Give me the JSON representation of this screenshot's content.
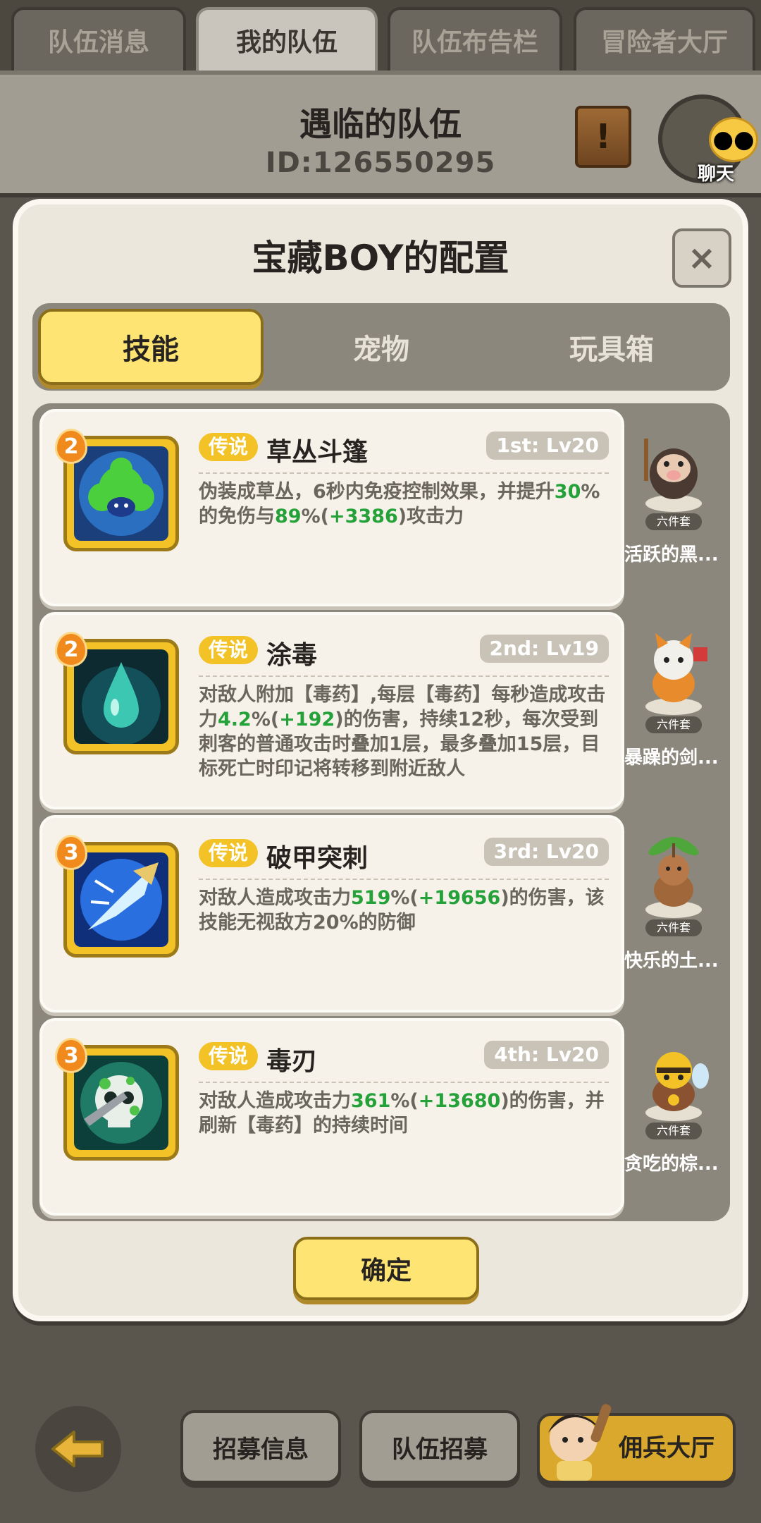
{
  "top_tabs": [
    "队伍消息",
    "我的队伍",
    "队伍布告栏",
    "冒险者大厅"
  ],
  "team": {
    "name": "遇临的队伍",
    "id": "ID:126550295"
  },
  "chat": {
    "label": "聊天"
  },
  "modal": {
    "title": "宝藏BOY的配置",
    "close_symbol": "×",
    "sub_tabs": [
      "技能",
      "宠物",
      "玩具箱"
    ],
    "confirm_label": "确定"
  },
  "skills": [
    {
      "rank": "2",
      "rarity": "传说",
      "name": "草丛斗篷",
      "level": "1st: Lv20",
      "description": [
        {
          "t": "伪装成草丛，6秒内免疫控制效果，并提升"
        },
        {
          "t": "30",
          "h": true
        },
        {
          "t": "%的免伤与"
        },
        {
          "t": "89",
          "h": true
        },
        {
          "t": "%("
        },
        {
          "t": "+3386",
          "h": true
        },
        {
          "t": ")攻击力"
        }
      ]
    },
    {
      "rank": "2",
      "rarity": "传说",
      "name": "涂毒",
      "level": "2nd: Lv19",
      "description": [
        {
          "t": "对敌人附加【毒药】,每层【毒药】每秒造成攻击力"
        },
        {
          "t": "4.2",
          "h": true
        },
        {
          "t": "%("
        },
        {
          "t": "+192",
          "h": true
        },
        {
          "t": ")的伤害，持续12秒，每次受到刺客的普通攻击时叠加1层，最多叠加15层，目标死亡时印记将转移到附近敌人"
        }
      ]
    },
    {
      "rank": "3",
      "rarity": "传说",
      "name": "破甲突刺",
      "level": "3rd: Lv20",
      "description": [
        {
          "t": "对敌人造成攻击力"
        },
        {
          "t": "519",
          "h": true
        },
        {
          "t": "%("
        },
        {
          "t": "+19656",
          "h": true
        },
        {
          "t": ")的伤害，该技能无视敌方20%的防御"
        }
      ]
    },
    {
      "rank": "3",
      "rarity": "传说",
      "name": "毒刃",
      "level": "4th: Lv20",
      "description": [
        {
          "t": "对敌人造成攻击力"
        },
        {
          "t": "361",
          "h": true
        },
        {
          "t": "%("
        },
        {
          "t": "+13680",
          "h": true
        },
        {
          "t": ")的伤害，并刷新【毒药】的持续时间"
        }
      ]
    }
  ],
  "pets": [
    {
      "name": "活跃的黑...",
      "set": "六件套"
    },
    {
      "name": "暴躁的剑...",
      "set": "六件套"
    },
    {
      "name": "快乐的土...",
      "set": "六件套"
    },
    {
      "name": "贪吃的棕...",
      "set": "六件套"
    }
  ],
  "bottom": {
    "recruit_info": "招募信息",
    "team_recruit": "队伍招募",
    "mercenary_hall": "佣兵大厅"
  },
  "colors": {
    "highlight": "#25a13a",
    "gold": "#f2c227",
    "panel": "#8c877d"
  }
}
